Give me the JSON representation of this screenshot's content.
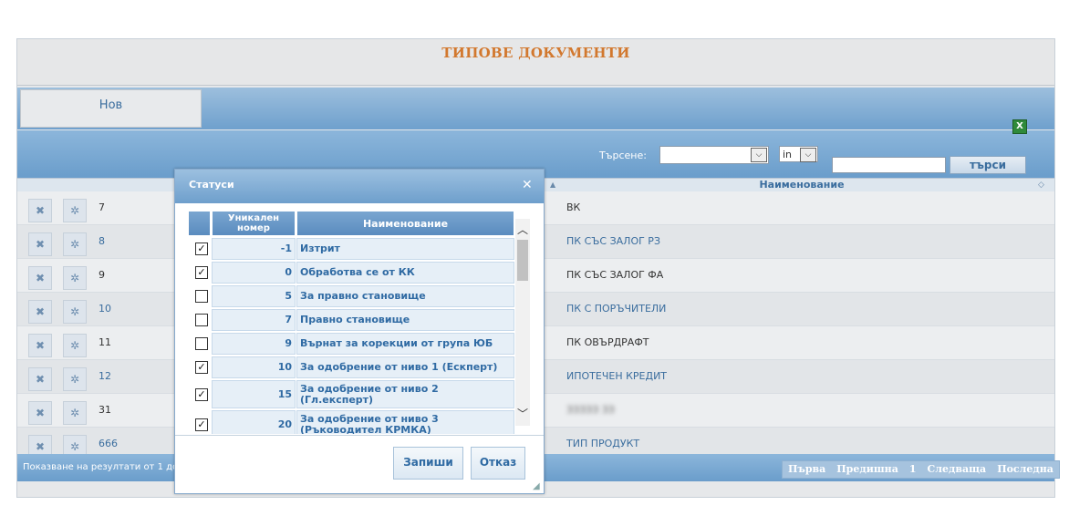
{
  "page": {
    "title": "ТИПОВЕ ДОКУМЕНТИ"
  },
  "toolbar": {
    "new_label": "Нов"
  },
  "search": {
    "label": "Търсене:",
    "select1_value": "",
    "select2_value": "in",
    "query_value": "",
    "button_label": "търси"
  },
  "grid": {
    "column_name": "Наименование",
    "rows": [
      {
        "id": "7",
        "name": "ВК"
      },
      {
        "id": "8",
        "name": "ПК СЪС ЗАЛОГ РЗ"
      },
      {
        "id": "9",
        "name": "ПК СЪС ЗАЛОГ ФА"
      },
      {
        "id": "10",
        "name": "ПК С ПОРЪЧИТЕЛИ"
      },
      {
        "id": "11",
        "name": "ПК ОВЪРДРАФТ"
      },
      {
        "id": "12",
        "name": "ИПОТЕЧЕН КРЕДИТ"
      },
      {
        "id": "31",
        "name": "ЗЗЗЗЗ ЗЗ"
      },
      {
        "id": "666",
        "name": "ТИП ПРОДУКТ"
      }
    ]
  },
  "footer": {
    "info": "Показване на резултати от 1 до",
    "pager": {
      "first": "Първа",
      "prev": "Предишна",
      "page": "1",
      "next": "Следваща",
      "last": "Последна"
    }
  },
  "modal": {
    "title": "Статуси",
    "col_number": "Уникален номер",
    "col_name": "Наименование",
    "rows": [
      {
        "checked": true,
        "number": "-1",
        "name": "Изтрит"
      },
      {
        "checked": true,
        "number": "0",
        "name": "Обработва се от КК"
      },
      {
        "checked": false,
        "number": "5",
        "name": "За правно становище"
      },
      {
        "checked": false,
        "number": "7",
        "name": "Правно становище"
      },
      {
        "checked": false,
        "number": "9",
        "name": "Върнат за корекции от група ЮБ"
      },
      {
        "checked": true,
        "number": "10",
        "name": "За одобрение от ниво 1 (Ескперт)"
      },
      {
        "checked": true,
        "number": "15",
        "name": "За одобрение от ниво 2 (Гл.експерт)"
      },
      {
        "checked": true,
        "number": "20",
        "name": "За одобрение от ниво 3 (Ръководител КРМКА)"
      }
    ],
    "save_label": "Запиши",
    "cancel_label": "Отказ"
  },
  "colors": {
    "title": "#d2782e",
    "accent": "#6a9dcb",
    "link": "#3a6d9e"
  }
}
